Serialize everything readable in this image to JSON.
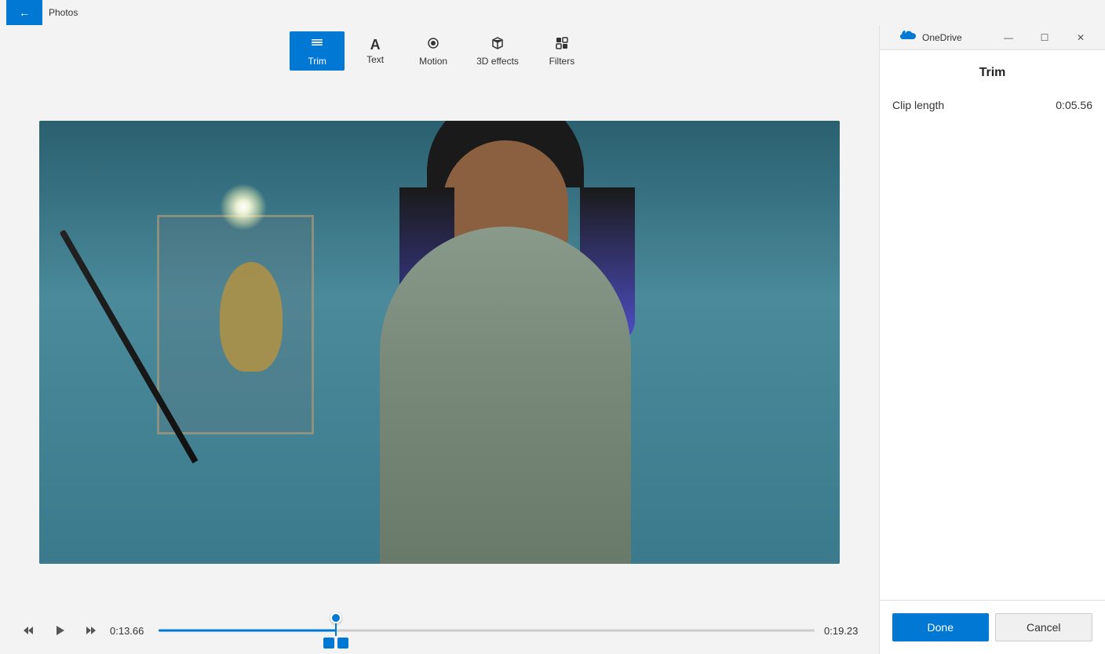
{
  "titlebar": {
    "app_name": "Photos",
    "back_label": "←"
  },
  "toolbar": {
    "buttons": [
      {
        "id": "trim",
        "label": "Trim",
        "icon": "⊟",
        "active": true
      },
      {
        "id": "text",
        "label": "Text",
        "icon": "A",
        "active": false
      },
      {
        "id": "motion",
        "label": "Motion",
        "icon": "◎",
        "active": false
      },
      {
        "id": "3d-effects",
        "label": "3D effects",
        "icon": "✦",
        "active": false
      },
      {
        "id": "filters",
        "label": "Filters",
        "icon": "▦",
        "active": false
      }
    ]
  },
  "controls": {
    "time_current": "0:13.66",
    "time_end": "0:19.23",
    "rewind_label": "⏮",
    "play_label": "▶",
    "forward_label": "⏭"
  },
  "right_panel": {
    "app_name": "OneDrive",
    "title": "Trim",
    "clip_length_label": "Clip length",
    "clip_length_value": "0:05.56",
    "btn_done": "Done",
    "btn_cancel": "Cancel"
  },
  "window_controls": {
    "minimize": "—",
    "maximize": "☐",
    "close": "✕"
  }
}
